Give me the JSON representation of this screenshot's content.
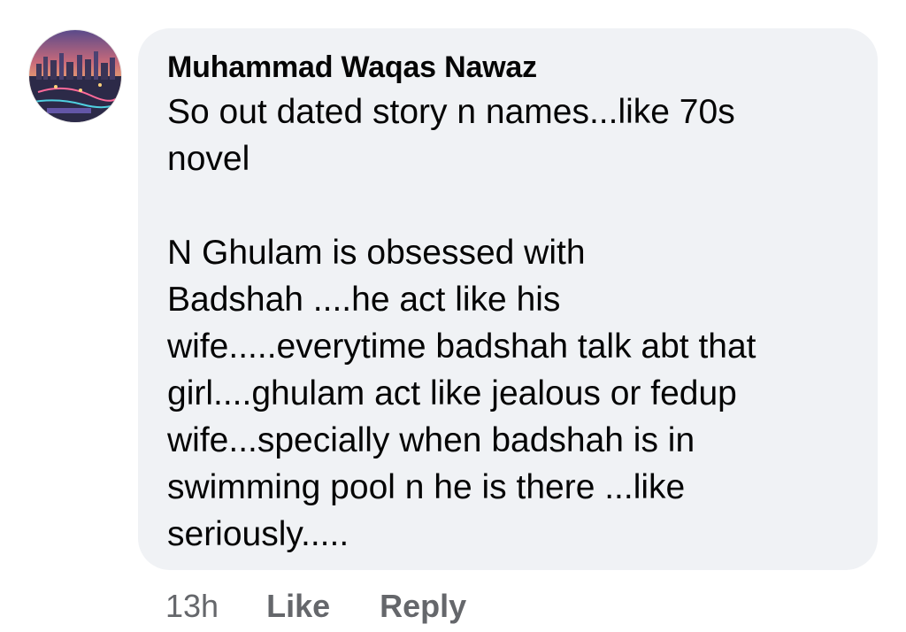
{
  "comment": {
    "author": "Muhammad Waqas Nawaz",
    "text": "So out dated story n names...like 70s\nnovel\n\nN Ghulam is obsessed with\nBadshah ....he act like his\nwife.....everytime badshah talk abt that\ngirl....ghulam act like jealous or fedup\nwife...specially when badshah is in\nswimming pool n he is there ...like\nseriously.....",
    "bubble_color": "#f0f2f5"
  },
  "actions": {
    "time": "13h",
    "like_label": "Like",
    "reply_label": "Reply"
  },
  "avatar": {
    "icon": "profile-photo-city-skyline"
  }
}
